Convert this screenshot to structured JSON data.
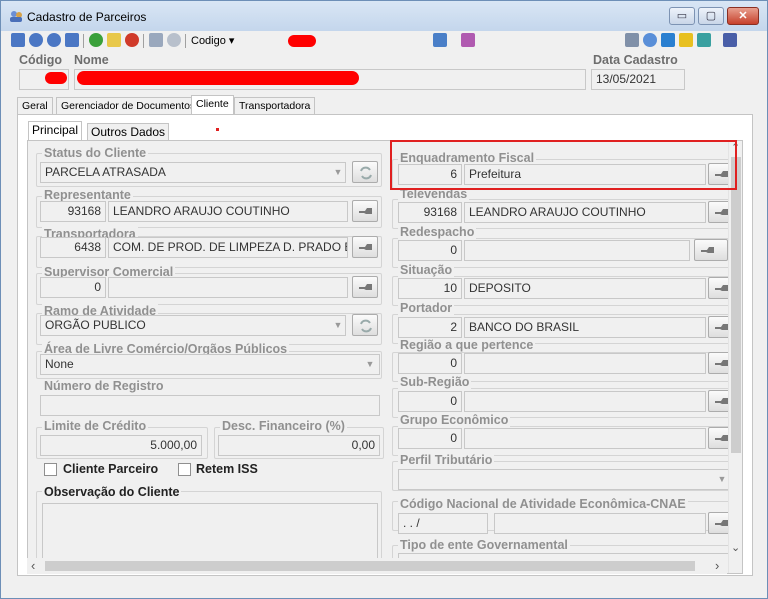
{
  "window": {
    "title": "Cadastro de Parceiros",
    "minimize": "▭",
    "maximize": "▢",
    "close": "✕"
  },
  "toolbar": {
    "codigo_label": "Codigo ▾"
  },
  "header": {
    "codigo_label": "Código",
    "nome_label": "Nome",
    "data_cadastro_label": "Data Cadastro",
    "data_cadastro_value": "13/05/2021"
  },
  "tabs": [
    "Geral",
    "Gerenciador de Documentos",
    "Cliente",
    "Transportadora"
  ],
  "subtabs": [
    "Principal",
    "Outros Dados"
  ],
  "left": {
    "status_label": "Status do Cliente",
    "status_value": "PARCELA ATRASADA",
    "representante_label": "Representante",
    "representante_code": "93168",
    "representante_name": "LEANDRO ARAUJO COUTINHO",
    "transportadora_label": "Transportadora",
    "transportadora_code": "6438",
    "transportadora_name": "COM. DE PROD. DE LIMPEZA D. PRADO E",
    "supervisor_label": "Supervisor Comercial",
    "supervisor_code": "0",
    "ramo_label": "Ramo de Atividade",
    "ramo_value": "ORGÃO PUBLICO",
    "area_label": "Área de Livre Comércio/Orgãos Públicos",
    "area_value": "None",
    "numero_registro_label": "Número de Registro",
    "limite_label": "Limite de Crédito",
    "limite_value": "5.000,00",
    "desc_label": "Desc. Financeiro (%)",
    "desc_value": "0,00",
    "cliente_parceiro_label": "Cliente Parceiro",
    "retem_iss_label": "Retem ISS",
    "observacao_label": "Observação do Cliente"
  },
  "right": {
    "enquadramento_label": "Enquadramento Fiscal",
    "enquadramento_code": "6",
    "enquadramento_name": "Prefeitura",
    "televendas_label": "Televendas",
    "televendas_code": "93168",
    "televendas_name": "LEANDRO ARAUJO COUTINHO",
    "redespacho_label": "Redespacho",
    "redespacho_code": "0",
    "situacao_label": "Situação",
    "situacao_code": "10",
    "situacao_name": "DEPOSITO",
    "portador_label": "Portador",
    "portador_code": "2",
    "portador_name": "BANCO DO BRASIL",
    "regiao_label": "Região a que pertence",
    "regiao_code": "0",
    "subregiao_label": "Sub-Região",
    "subregiao_code": "0",
    "grupo_label": "Grupo Econômico",
    "grupo_code": "0",
    "perfil_label": "Perfil Tributário",
    "cnae_label": "Código Nacional de Atividade Econômica-CNAE",
    "cnae_value": ". . /",
    "tipo_ente_label": "Tipo de ente Governamental"
  },
  "scroll": {
    "up": "⌃",
    "down": "⌄",
    "left": "‹",
    "right": "›"
  },
  "colors": {
    "highlight": "#e02020",
    "redaction": "#ff0000"
  }
}
